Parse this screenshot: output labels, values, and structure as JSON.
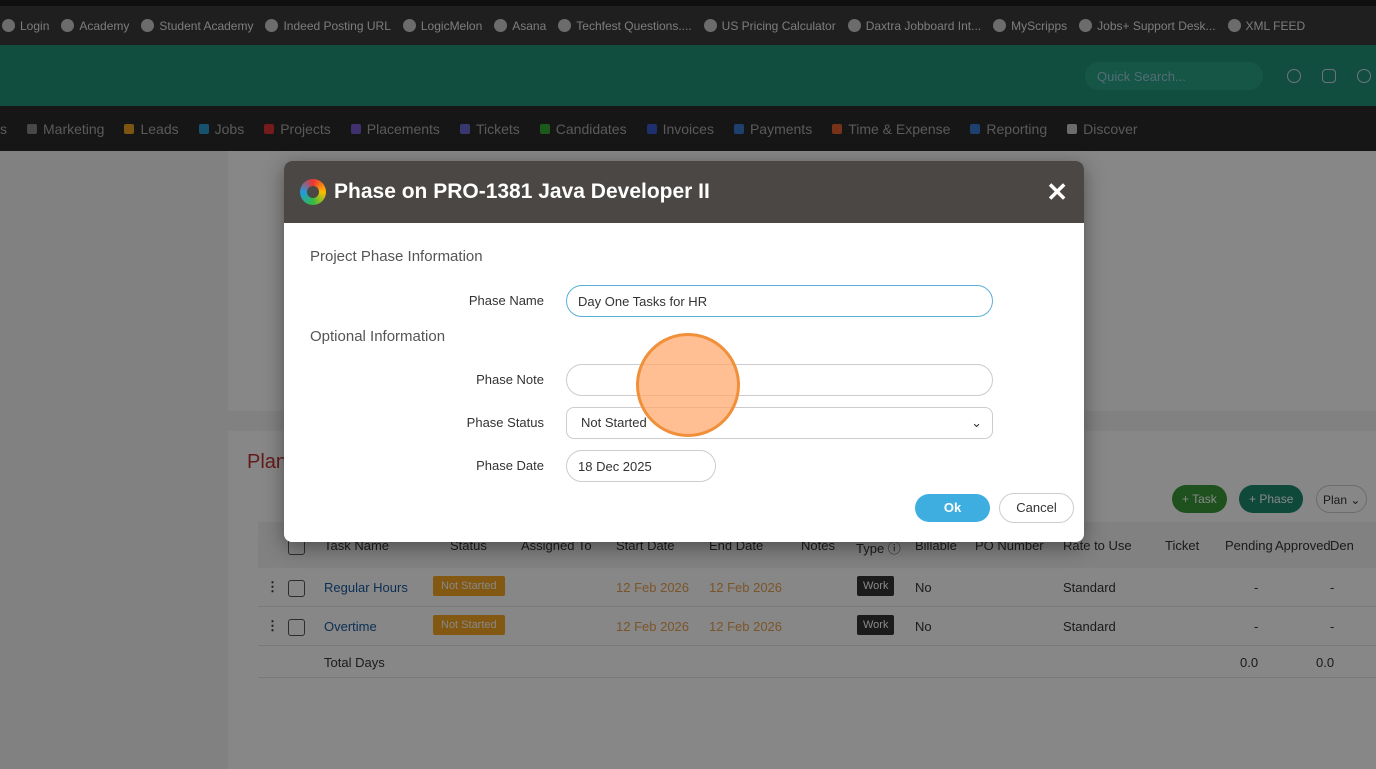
{
  "bookmarks": [
    "Login",
    "Academy",
    "Student Academy",
    "Indeed Posting URL",
    "LogicMelon",
    "Asana",
    "Techfest Questions....",
    "US Pricing Calculator",
    "Daxtra Jobboard Int...",
    "MyScripps",
    "Jobs+ Support Desk...",
    "XML FEED"
  ],
  "header": {
    "search_placeholder": "Quick Search..."
  },
  "nav": [
    "s",
    "Marketing",
    "Leads",
    "Jobs",
    "Projects",
    "Placements",
    "Tickets",
    "Candidates",
    "Invoices",
    "Payments",
    "Time & Expense",
    "Reporting",
    "Discover"
  ],
  "plan": {
    "title": "Plan",
    "task_btn": "+ Task",
    "phase_btn": "+ Phase",
    "plan_btn": "Plan ⌄",
    "columns": [
      "Task Name",
      "Status",
      "Assigned To",
      "Start Date",
      "End Date",
      "Notes",
      "Type ⓘ",
      "Billable",
      "PO Number",
      "Rate to Use",
      "Ticket",
      "Pending",
      "Approved",
      "Den"
    ],
    "rows": [
      {
        "name": "Regular Hours",
        "status": "Not Started",
        "start": "12 Feb 2026",
        "end": "12 Feb 2026",
        "type": "Work",
        "billable": "No",
        "rate": "Standard",
        "pending": "-",
        "approved": "-"
      },
      {
        "name": "Overtime",
        "status": "Not Started",
        "start": "12 Feb 2026",
        "end": "12 Feb 2026",
        "type": "Work",
        "billable": "No",
        "rate": "Standard",
        "pending": "-",
        "approved": "-"
      }
    ],
    "total": {
      "label": "Total Days",
      "pending": "0.0",
      "approved": "0.0"
    }
  },
  "modal": {
    "title": "Phase on PRO-1381 Java Developer II",
    "close": "✕",
    "section1": "Project Phase Information",
    "section2": "Optional Information",
    "phase_name_label": "Phase Name",
    "phase_name": "Day One Tasks for HR",
    "phase_note_label": "Phase Note",
    "phase_note": "",
    "phase_status_label": "Phase Status",
    "phase_status": "Not Started",
    "phase_date_label": "Phase Date",
    "phase_date": "18 Dec 2025",
    "ok": "Ok",
    "cancel": "Cancel"
  }
}
